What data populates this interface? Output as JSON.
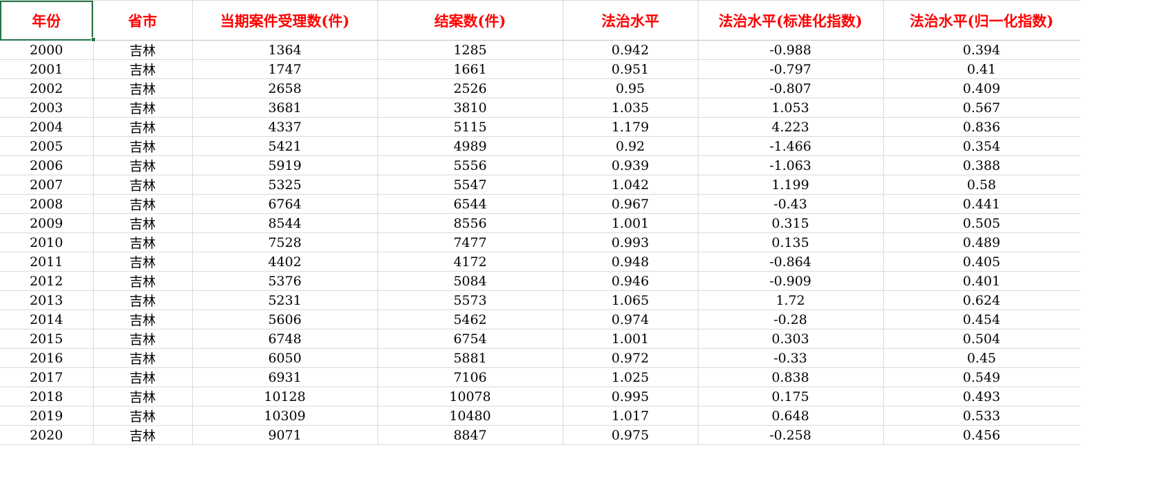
{
  "spreadsheet": {
    "headers": [
      "年份",
      "省市",
      "当期案件受理数(件)",
      "结案数(件)",
      "法治水平",
      "法治水平(标准化指数)",
      "法治水平(归一化指数)"
    ],
    "rows": [
      [
        "2000",
        "吉林",
        "1364",
        "1285",
        "0.942",
        "-0.988",
        "0.394"
      ],
      [
        "2001",
        "吉林",
        "1747",
        "1661",
        "0.951",
        "-0.797",
        "0.41"
      ],
      [
        "2002",
        "吉林",
        "2658",
        "2526",
        "0.95",
        "-0.807",
        "0.409"
      ],
      [
        "2003",
        "吉林",
        "3681",
        "3810",
        "1.035",
        "1.053",
        "0.567"
      ],
      [
        "2004",
        "吉林",
        "4337",
        "5115",
        "1.179",
        "4.223",
        "0.836"
      ],
      [
        "2005",
        "吉林",
        "5421",
        "4989",
        "0.92",
        "-1.466",
        "0.354"
      ],
      [
        "2006",
        "吉林",
        "5919",
        "5556",
        "0.939",
        "-1.063",
        "0.388"
      ],
      [
        "2007",
        "吉林",
        "5325",
        "5547",
        "1.042",
        "1.199",
        "0.58"
      ],
      [
        "2008",
        "吉林",
        "6764",
        "6544",
        "0.967",
        "-0.43",
        "0.441"
      ],
      [
        "2009",
        "吉林",
        "8544",
        "8556",
        "1.001",
        "0.315",
        "0.505"
      ],
      [
        "2010",
        "吉林",
        "7528",
        "7477",
        "0.993",
        "0.135",
        "0.489"
      ],
      [
        "2011",
        "吉林",
        "4402",
        "4172",
        "0.948",
        "-0.864",
        "0.405"
      ],
      [
        "2012",
        "吉林",
        "5376",
        "5084",
        "0.946",
        "-0.909",
        "0.401"
      ],
      [
        "2013",
        "吉林",
        "5231",
        "5573",
        "1.065",
        "1.72",
        "0.624"
      ],
      [
        "2014",
        "吉林",
        "5606",
        "5462",
        "0.974",
        "-0.28",
        "0.454"
      ],
      [
        "2015",
        "吉林",
        "6748",
        "6754",
        "1.001",
        "0.303",
        "0.504"
      ],
      [
        "2016",
        "吉林",
        "6050",
        "5881",
        "0.972",
        "-0.33",
        "0.45"
      ],
      [
        "2017",
        "吉林",
        "6931",
        "7106",
        "1.025",
        "0.838",
        "0.549"
      ],
      [
        "2018",
        "吉林",
        "10128",
        "10078",
        "0.995",
        "0.175",
        "0.493"
      ],
      [
        "2019",
        "吉林",
        "10309",
        "10480",
        "1.017",
        "0.648",
        "0.533"
      ],
      [
        "2020",
        "吉林",
        "9071",
        "8847",
        "0.975",
        "-0.258",
        "0.456"
      ]
    ]
  },
  "colors": {
    "header_text": "#ff0000",
    "selection": "#217346",
    "grid": "#d9d9d9"
  }
}
